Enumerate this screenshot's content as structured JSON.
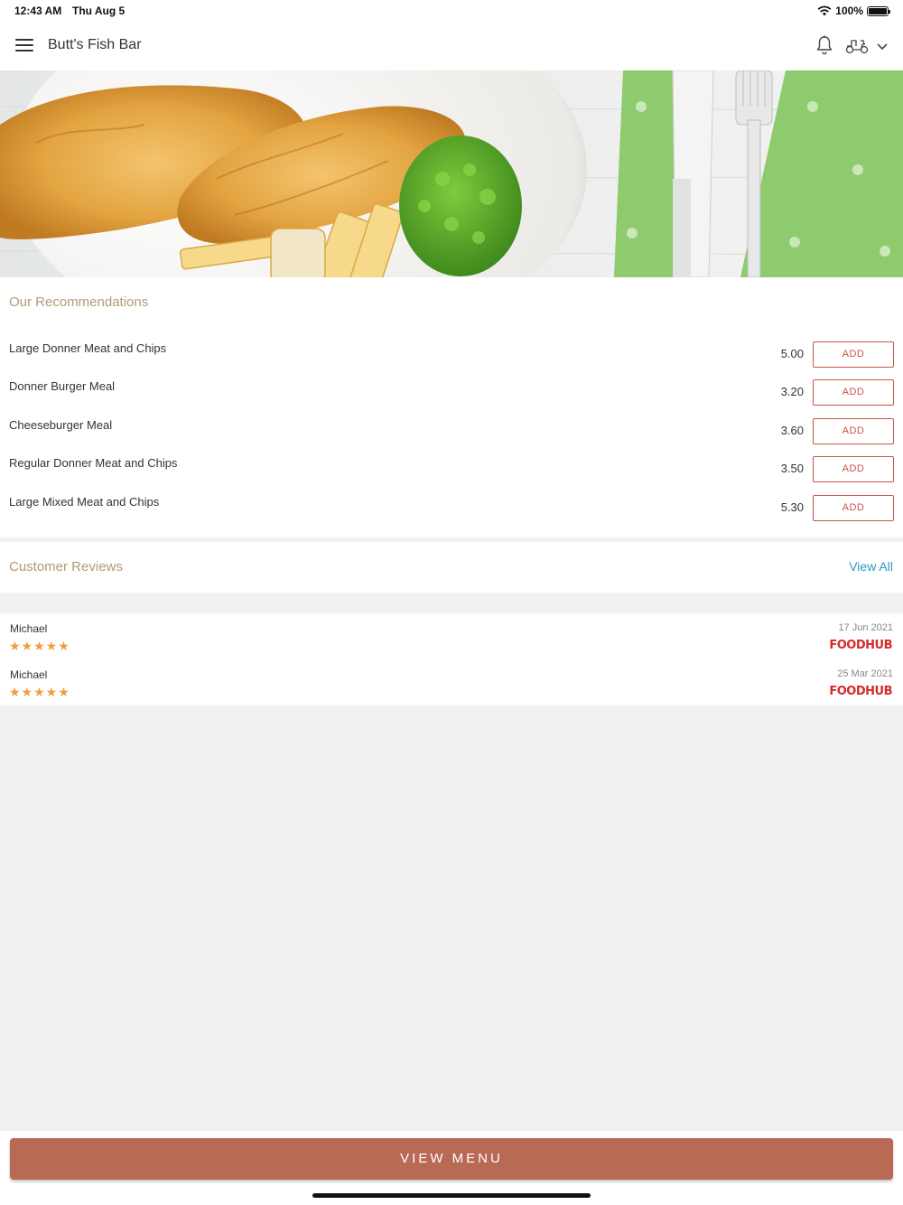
{
  "status_bar": {
    "time": "12:43 AM",
    "date": "Thu Aug 5",
    "battery": "100%"
  },
  "header": {
    "title": "Butt's Fish Bar"
  },
  "recommendations": {
    "title": "Our Recommendations",
    "add_label": "ADD",
    "items": [
      {
        "name": "Large Donner Meat and Chips",
        "price": "5.00"
      },
      {
        "name": "Donner Burger Meal",
        "price": "3.20"
      },
      {
        "name": "Cheeseburger Meal",
        "price": "3.60"
      },
      {
        "name": "Regular Donner Meat and Chips",
        "price": "3.50"
      },
      {
        "name": "Large Mixed Meat and Chips",
        "price": "5.30"
      }
    ]
  },
  "reviews": {
    "title": "Customer Reviews",
    "view_all": "View All",
    "items": [
      {
        "name": "Michael",
        "stars": "★★★★★",
        "rating": 5,
        "date": "17 Jun 2021",
        "source": "FOODHUB"
      },
      {
        "name": "Michael",
        "stars": "★★★★★",
        "rating": 5,
        "date": "25 Mar 2021",
        "source": "FOODHUB"
      }
    ]
  },
  "footer": {
    "view_menu": "VIEW MENU"
  },
  "colors": {
    "accent": "#b86a55",
    "section_title": "#b39a73",
    "add_border": "#c9544a",
    "link": "#2b9cc0",
    "stars": "#f29d38",
    "foodhub": "#d62a2a"
  }
}
